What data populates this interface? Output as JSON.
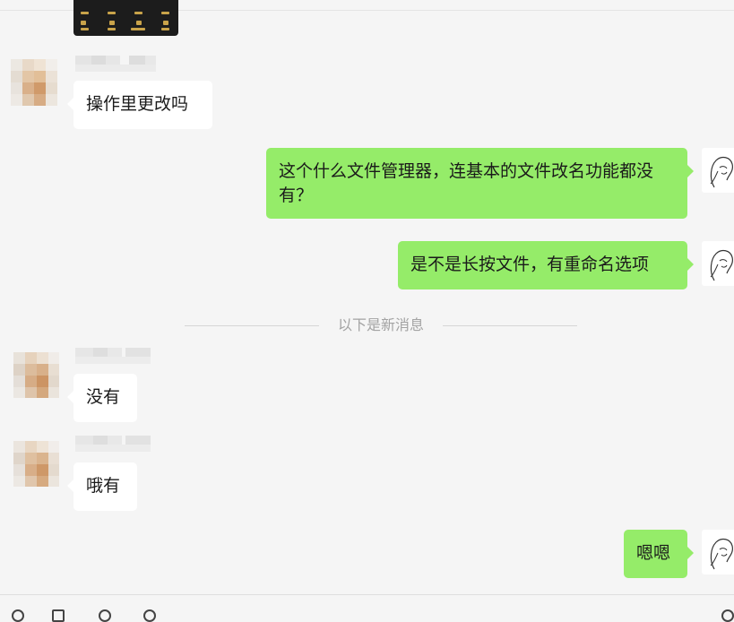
{
  "messages": [
    {
      "side": "in",
      "text": "操作里更改吗"
    },
    {
      "side": "out",
      "text": "这个什么文件管理器，连基本的文件改名功能都没有？"
    },
    {
      "side": "out",
      "text": "是不是长按文件，有重命名选项"
    },
    {
      "side": "in",
      "text": "没有"
    },
    {
      "side": "in",
      "text": "哦有"
    },
    {
      "side": "out",
      "text": "嗯嗯"
    }
  ],
  "divider": {
    "text": "以下是新消息"
  },
  "colors": {
    "background": "#f5f5f5",
    "incoming_bubble": "#ffffff",
    "outgoing_bubble": "#95ec69",
    "divider_text": "#a3a3a3"
  },
  "icons": [
    "image-thumbnail",
    "contact-avatar",
    "own-avatar-sketch",
    "emoji-icon",
    "folder-icon",
    "scissors-icon",
    "chat-history-icon",
    "phone-icon"
  ]
}
